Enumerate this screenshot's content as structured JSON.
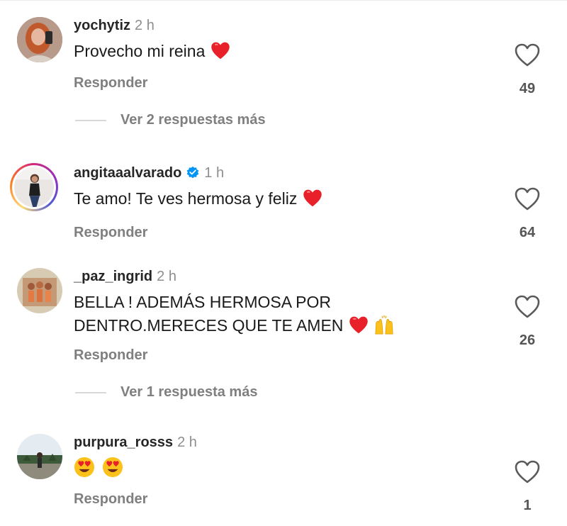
{
  "comments": [
    {
      "username": "yochytiz",
      "time": "2 h",
      "text": "Provecho mi reina",
      "reply_label": "Responder",
      "likes": "49",
      "more_replies": "Ver 2 respuestas más"
    },
    {
      "username": "angitaaalvarado",
      "verified": true,
      "time": "1 h",
      "text": "Te amo! Te ves hermosa y feliz",
      "reply_label": "Responder",
      "likes": "64"
    },
    {
      "username": "_paz_ingrid",
      "time": "2 h",
      "text_line1": "BELLA ! ADEMÁS HERMOSA POR",
      "text_line2": "DENTRO.MERECES QUE TE AMEN",
      "reply_label": "Responder",
      "likes": "26",
      "more_replies": "Ver 1 respuesta más"
    },
    {
      "username": "purpura_rosss",
      "time": "2 h",
      "reply_label": "Responder",
      "likes": "1"
    }
  ],
  "colors": {
    "heart_red": "#e8202a",
    "verified_blue": "#0095f6",
    "emoji_yellow": "#fcc21b"
  },
  "icons": {
    "like": "heart-outline-icon",
    "verified": "verified-badge-icon",
    "emoji_heart": "red-heart-emoji",
    "emoji_hands": "raising-hands-emoji",
    "emoji_heart_eyes": "heart-eyes-emoji"
  }
}
